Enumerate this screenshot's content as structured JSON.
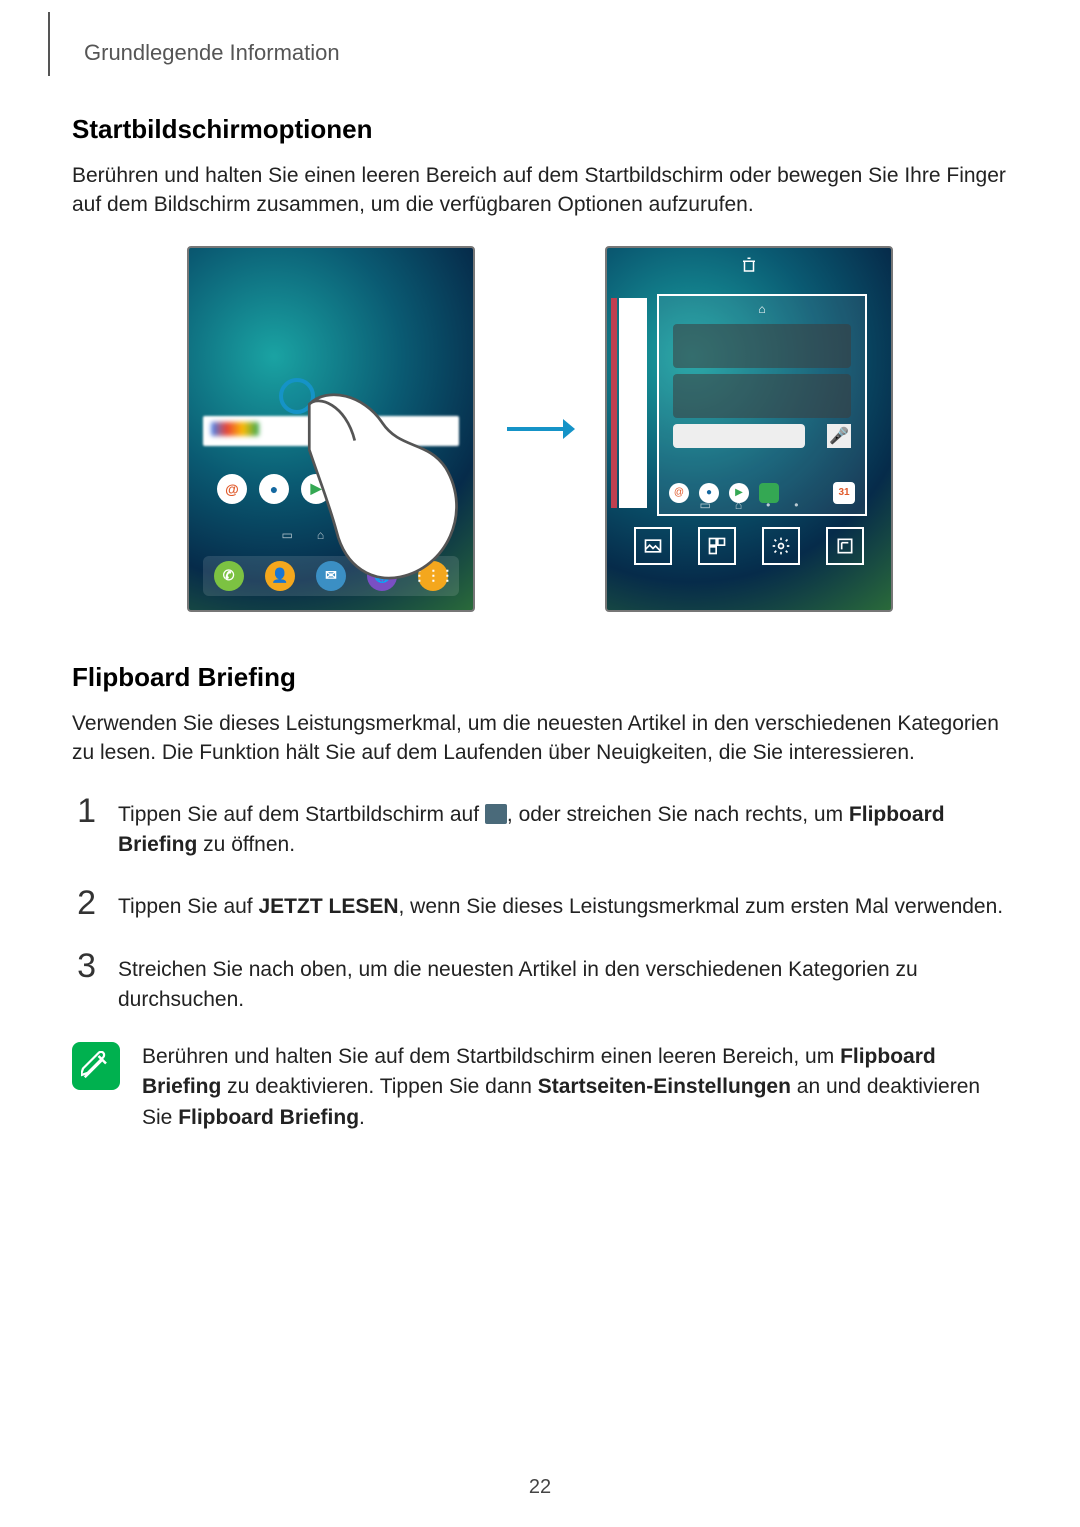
{
  "breadcrumb": "Grundlegende Information",
  "section1": {
    "title": "Startbildschirmoptionen",
    "body": "Berühren und halten Sie einen leeren Bereich auf dem Startbildschirm oder bewegen Sie Ihre Finger auf dem Bildschirm zusammen, um die verfügbaren Optionen aufzurufen."
  },
  "section2": {
    "title": "Flipboard Briefing",
    "body": "Verwenden Sie dieses Leistungsmerkmal, um die neuesten Artikel in den verschiedenen Kategorien zu lesen. Die Funktion hält Sie auf dem Laufenden über Neuigkeiten, die Sie interessieren."
  },
  "steps": [
    {
      "num": "1",
      "pre": "Tippen Sie auf dem Startbildschirm auf ",
      "post": ", oder streichen Sie nach rechts, um ",
      "bold": "Flipboard Briefing",
      "tail": " zu öffnen."
    },
    {
      "num": "2",
      "pre": "Tippen Sie auf ",
      "bold": "JETZT LESEN",
      "post": ", wenn Sie dieses Leistungsmerkmal zum ersten Mal verwenden."
    },
    {
      "num": "3",
      "text": "Streichen Sie nach oben, um die neuesten Artikel in den verschiedenen Kategorien zu durchsuchen."
    }
  ],
  "note": {
    "t1": "Berühren und halten Sie auf dem Startbildschirm einen leeren Bereich, um ",
    "b1": "Flipboard Briefing",
    "t2": " zu deaktivieren. Tippen Sie dann ",
    "b2": "Startseiten-Einstellungen",
    "t3": " an und deaktivieren Sie ",
    "b3": "Flipboard Briefing",
    "t4": "."
  },
  "figure": {
    "right_calendar_label": "31"
  },
  "page_number": "22"
}
